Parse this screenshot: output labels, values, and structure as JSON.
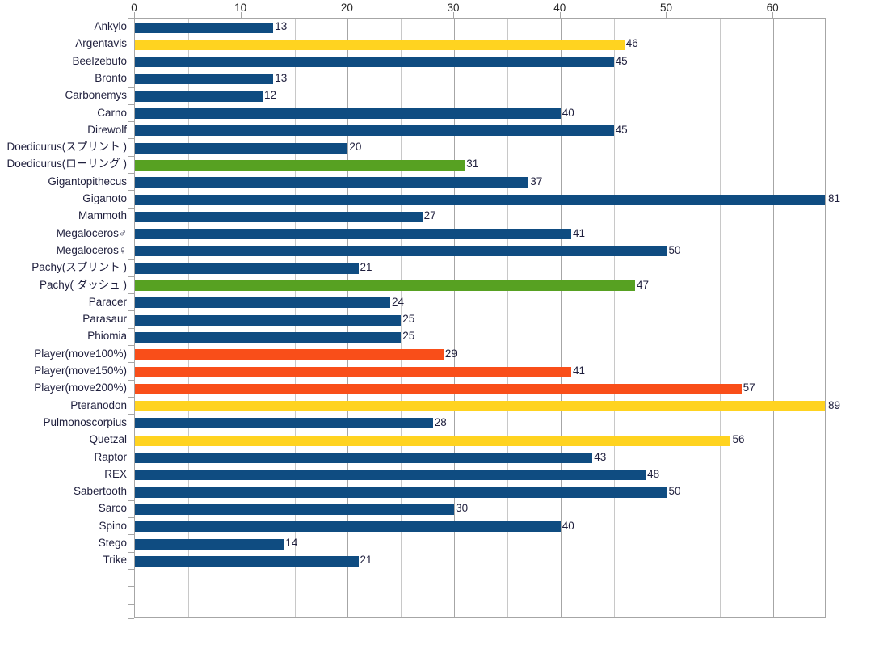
{
  "chart_data": {
    "type": "bar",
    "orientation": "horizontal",
    "title": "",
    "subtitle": "",
    "xlabel": "",
    "ylabel": "",
    "xlim": [
      0,
      65
    ],
    "ylim": null,
    "grid": true,
    "legend": "none",
    "x_axis_position": "top",
    "x_ticks": [
      0,
      10,
      20,
      30,
      40,
      50,
      60
    ],
    "x_minor_ticks": [
      5,
      15,
      25,
      35,
      45,
      55
    ],
    "categories": [
      "Ankylo",
      "Argentavis",
      "Beelzebufo",
      "Bronto",
      "Carbonemys",
      "Carno",
      "Direwolf",
      "Doedicurus(スプリント )",
      "Doedicurus(ローリング )",
      "Gigantopithecus",
      "Giganoto",
      "Mammoth",
      "Megaloceros♂",
      "Megaloceros♀",
      "Pachy(スプリント )",
      "Pachy( ダッシュ )",
      "Paracer",
      "Parasaur",
      "Phiomia",
      "Player(move100%)",
      "Player(move150%)",
      "Player(move200%)",
      "Pteranodon",
      "Pulmonoscorpius",
      "Quetzal",
      "Raptor",
      "REX",
      "Sabertooth",
      "Sarco",
      "Spino",
      "Stego",
      "Trike"
    ],
    "values": [
      13,
      46,
      45,
      13,
      12,
      40,
      45,
      20,
      31,
      37,
      81,
      27,
      41,
      50,
      21,
      47,
      24,
      25,
      25,
      29,
      41,
      57,
      89,
      28,
      56,
      43,
      48,
      50,
      30,
      40,
      14,
      21
    ],
    "colors": [
      "#0F4C81",
      "#FFD320",
      "#0F4C81",
      "#0F4C81",
      "#0F4C81",
      "#0F4C81",
      "#0F4C81",
      "#0F4C81",
      "#57A122",
      "#0F4C81",
      "#0F4C81",
      "#0F4C81",
      "#0F4C81",
      "#0F4C81",
      "#0F4C81",
      "#57A122",
      "#0F4C81",
      "#0F4C81",
      "#0F4C81",
      "#F94E19",
      "#F94E19",
      "#F94E19",
      "#FFD320",
      "#0F4C81",
      "#FFD320",
      "#0F4C81",
      "#0F4C81",
      "#0F4C81",
      "#0F4C81",
      "#0F4C81",
      "#0F4C81",
      "#0F4C81"
    ],
    "palette": {
      "blue": "#0F4C81",
      "yellow": "#FFD320",
      "green": "#57A122",
      "orange": "#F94E19",
      "gridline": "#c8c8c8",
      "axis": "#a6a6a6"
    }
  }
}
